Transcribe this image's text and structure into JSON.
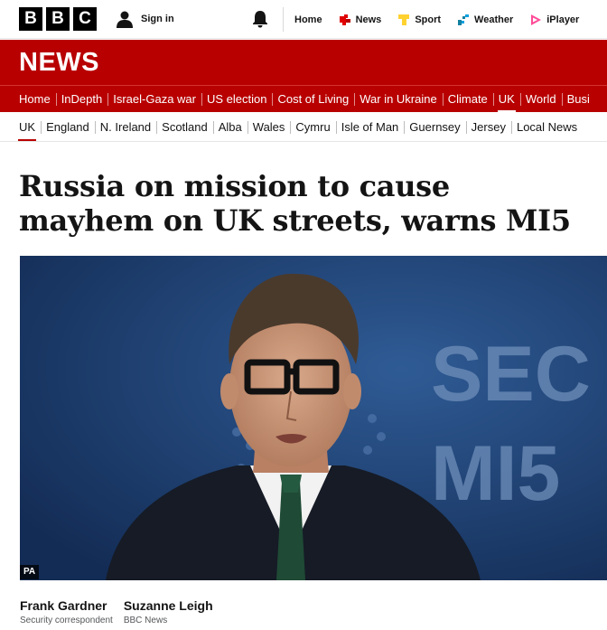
{
  "header": {
    "logo_letters": [
      "B",
      "B",
      "C"
    ],
    "signin_label": "Sign in",
    "nav": [
      {
        "label": "Home",
        "icon": "none"
      },
      {
        "label": "News",
        "icon": "news-icon",
        "color": "#e00000"
      },
      {
        "label": "Sport",
        "icon": "sport-icon",
        "color": "#ffd230"
      },
      {
        "label": "Weather",
        "icon": "weather-icon",
        "color": "#1380a1"
      },
      {
        "label": "iPlayer",
        "icon": "iplayer-icon",
        "color": "#ff4c98"
      }
    ]
  },
  "banner": {
    "title": "NEWS",
    "color": "#b80000"
  },
  "primary_nav": {
    "items": [
      "Home",
      "InDepth",
      "Israel-Gaza war",
      "US election",
      "Cost of Living",
      "War in Ukraine",
      "Climate",
      "UK",
      "World",
      "Busi"
    ],
    "active": "UK"
  },
  "secondary_nav": {
    "items": [
      "UK",
      "England",
      "N. Ireland",
      "Scotland",
      "Alba",
      "Wales",
      "Cymru",
      "Isle of Man",
      "Guernsey",
      "Jersey",
      "Local News"
    ],
    "active": "UK"
  },
  "article": {
    "headline": "Russia on mission to cause mayhem on UK streets, warns MI5",
    "image_credit": "PA",
    "backdrop_text": [
      "SEC",
      "MI5"
    ],
    "bylines": [
      {
        "name": "Frank Gardner",
        "role": "Security correspondent"
      },
      {
        "name": "Suzanne Leigh",
        "role": "BBC News"
      }
    ]
  }
}
